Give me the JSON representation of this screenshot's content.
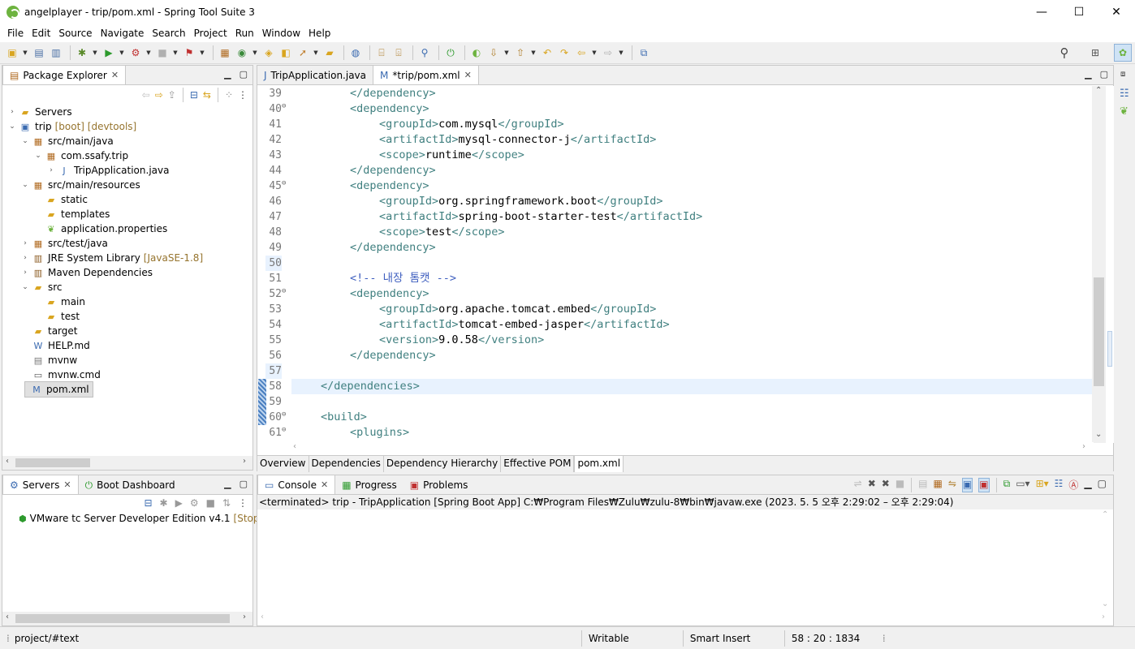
{
  "window": {
    "title": "angelplayer - trip/pom.xml - Spring Tool Suite 3",
    "minimize": "—",
    "maximize": "☐",
    "close": "✕"
  },
  "menu": [
    "File",
    "Edit",
    "Source",
    "Navigate",
    "Search",
    "Project",
    "Run",
    "Window",
    "Help"
  ],
  "package_explorer": {
    "tab_label": "Package Explorer",
    "tree": [
      {
        "label": "Servers",
        "indent": 0,
        "twisty": "›",
        "icon": "folder-icon"
      },
      {
        "label": "trip",
        "deco": "[boot] [devtools]",
        "indent": 0,
        "twisty": "⌄",
        "icon": "maven-project-icon"
      },
      {
        "label": "src/main/java",
        "indent": 1,
        "twisty": "⌄",
        "icon": "source-folder-icon"
      },
      {
        "label": "com.ssafy.trip",
        "indent": 2,
        "twisty": "⌄",
        "icon": "package-icon"
      },
      {
        "label": "TripApplication.java",
        "indent": 3,
        "twisty": "›",
        "icon": "java-file-icon"
      },
      {
        "label": "src/main/resources",
        "indent": 1,
        "twisty": "⌄",
        "icon": "source-folder-icon"
      },
      {
        "label": "static",
        "indent": 2,
        "twisty": "",
        "icon": "folder-icon"
      },
      {
        "label": "templates",
        "indent": 2,
        "twisty": "",
        "icon": "folder-icon"
      },
      {
        "label": "application.properties",
        "indent": 2,
        "twisty": "",
        "icon": "spring-properties-icon"
      },
      {
        "label": "src/test/java",
        "indent": 1,
        "twisty": "›",
        "icon": "source-folder-icon"
      },
      {
        "label": "JRE System Library",
        "deco": "[JavaSE-1.8]",
        "indent": 1,
        "twisty": "›",
        "icon": "library-icon"
      },
      {
        "label": "Maven Dependencies",
        "indent": 1,
        "twisty": "›",
        "icon": "library-icon"
      },
      {
        "label": "src",
        "indent": 1,
        "twisty": "⌄",
        "icon": "folder-icon"
      },
      {
        "label": "main",
        "indent": 2,
        "twisty": "",
        "icon": "folder-icon"
      },
      {
        "label": "test",
        "indent": 2,
        "twisty": "",
        "icon": "folder-icon"
      },
      {
        "label": "target",
        "indent": 1,
        "twisty": "",
        "icon": "folder-icon"
      },
      {
        "label": "HELP.md",
        "indent": 1,
        "twisty": "",
        "icon": "markdown-file-icon"
      },
      {
        "label": "mvnw",
        "indent": 1,
        "twisty": "",
        "icon": "text-file-icon"
      },
      {
        "label": "mvnw.cmd",
        "indent": 1,
        "twisty": "",
        "icon": "cmd-file-icon"
      },
      {
        "label": "pom.xml",
        "indent": 1,
        "twisty": "",
        "icon": "xml-file-icon",
        "selected": true
      }
    ]
  },
  "servers_panel": {
    "tab_servers": "Servers",
    "tab_boot": "Boot Dashboard",
    "server_name": "VMware tc Server Developer Edition v4.1",
    "server_state": "[Stoppe"
  },
  "editor": {
    "tabs": [
      {
        "label": "TripApplication.java",
        "active": false
      },
      {
        "label": "*trip/pom.xml",
        "active": true
      }
    ],
    "lines": [
      {
        "n": "39",
        "fold": "",
        "indent": 8,
        "parts": [
          [
            "tag",
            "</dependency>"
          ]
        ]
      },
      {
        "n": "40",
        "fold": "⊖",
        "indent": 8,
        "parts": [
          [
            "tag",
            "<dependency>"
          ]
        ]
      },
      {
        "n": "41",
        "fold": "",
        "indent": 12,
        "parts": [
          [
            "tag",
            "<groupId>"
          ],
          [
            "txt",
            "com.mysql"
          ],
          [
            "tag",
            "</groupId>"
          ]
        ]
      },
      {
        "n": "42",
        "fold": "",
        "indent": 12,
        "parts": [
          [
            "tag",
            "<artifactId>"
          ],
          [
            "txt",
            "mysql-connector-j"
          ],
          [
            "tag",
            "</artifactId>"
          ]
        ]
      },
      {
        "n": "43",
        "fold": "",
        "indent": 12,
        "parts": [
          [
            "tag",
            "<scope>"
          ],
          [
            "txt",
            "runtime"
          ],
          [
            "tag",
            "</scope>"
          ]
        ]
      },
      {
        "n": "44",
        "fold": "",
        "indent": 8,
        "parts": [
          [
            "tag",
            "</dependency>"
          ]
        ]
      },
      {
        "n": "45",
        "fold": "⊖",
        "indent": 8,
        "parts": [
          [
            "tag",
            "<dependency>"
          ]
        ]
      },
      {
        "n": "46",
        "fold": "",
        "indent": 12,
        "parts": [
          [
            "tag",
            "<groupId>"
          ],
          [
            "txt",
            "org.springframework.boot"
          ],
          [
            "tag",
            "</groupId>"
          ]
        ]
      },
      {
        "n": "47",
        "fold": "",
        "indent": 12,
        "parts": [
          [
            "tag",
            "<artifactId>"
          ],
          [
            "txt",
            "spring-boot-starter-test"
          ],
          [
            "tag",
            "</artifactId>"
          ]
        ]
      },
      {
        "n": "48",
        "fold": "",
        "indent": 12,
        "parts": [
          [
            "tag",
            "<scope>"
          ],
          [
            "txt",
            "test"
          ],
          [
            "tag",
            "</scope>"
          ]
        ]
      },
      {
        "n": "49",
        "fold": "",
        "indent": 8,
        "parts": [
          [
            "tag",
            "</dependency>"
          ]
        ]
      },
      {
        "n": "50",
        "fold": "",
        "indent": 0,
        "parts": []
      },
      {
        "n": "51",
        "fold": "",
        "indent": 8,
        "parts": [
          [
            "cmt",
            "<!-- 내장 톰캣 -->"
          ]
        ]
      },
      {
        "n": "52",
        "fold": "⊖",
        "indent": 8,
        "parts": [
          [
            "tag",
            "<dependency>"
          ]
        ]
      },
      {
        "n": "53",
        "fold": "",
        "indent": 12,
        "parts": [
          [
            "tag",
            "<groupId>"
          ],
          [
            "txt",
            "org.apache.tomcat.embed"
          ],
          [
            "tag",
            "</groupId>"
          ]
        ]
      },
      {
        "n": "54",
        "fold": "",
        "indent": 12,
        "parts": [
          [
            "tag",
            "<artifactId>"
          ],
          [
            "txt",
            "tomcat-embed-jasper"
          ],
          [
            "tag",
            "</artifactId>"
          ]
        ]
      },
      {
        "n": "55",
        "fold": "",
        "indent": 12,
        "parts": [
          [
            "tag",
            "<version>"
          ],
          [
            "txt",
            "9.0.58"
          ],
          [
            "tag",
            "</version>"
          ]
        ]
      },
      {
        "n": "56",
        "fold": "",
        "indent": 8,
        "parts": [
          [
            "tag",
            "</dependency>"
          ]
        ]
      },
      {
        "n": "57",
        "fold": "",
        "indent": 0,
        "parts": []
      },
      {
        "n": "58",
        "fold": "",
        "indent": 4,
        "parts": [
          [
            "tag",
            "</dependencies>"
          ]
        ],
        "current": true
      },
      {
        "n": "59",
        "fold": "",
        "indent": 0,
        "parts": []
      },
      {
        "n": "60",
        "fold": "⊖",
        "indent": 4,
        "parts": [
          [
            "tag",
            "<build>"
          ]
        ]
      },
      {
        "n": "61",
        "fold": "⊖",
        "indent": 8,
        "parts": [
          [
            "tag",
            "<plugins>"
          ]
        ]
      }
    ],
    "bottom_tabs": [
      {
        "label": "Overview",
        "active": false
      },
      {
        "label": "Dependencies",
        "active": false
      },
      {
        "label": "Dependency Hierarchy",
        "active": false
      },
      {
        "label": "Effective POM",
        "active": false
      },
      {
        "label": "pom.xml",
        "active": true
      }
    ]
  },
  "console": {
    "tab_console": "Console",
    "tab_progress": "Progress",
    "tab_problems": "Problems",
    "status_line": "<terminated> trip - TripApplication [Spring Boot App] C:₩Program Files₩Zulu₩zulu-8₩bin₩javaw.exe  (2023. 5. 5 오후 2:29:02 – 오후 2:29:04)"
  },
  "statusbar": {
    "path": "project/#text",
    "writable": "Writable",
    "insert_mode": "Smart Insert",
    "position": "58 : 20 : 1834"
  }
}
